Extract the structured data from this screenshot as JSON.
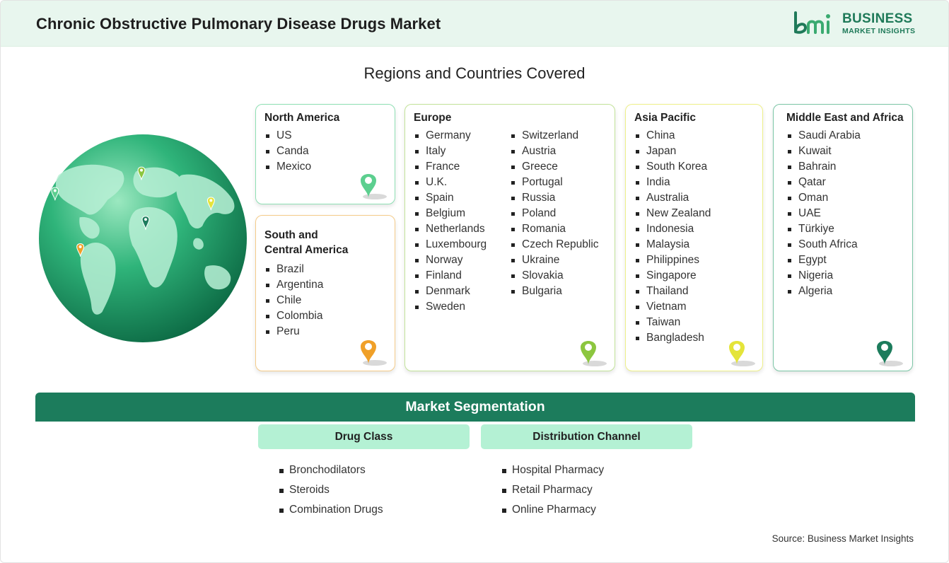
{
  "header": {
    "title": "Chronic Obstructive Pulmonary Disease Drugs Market"
  },
  "logo": {
    "line1": "BUSINESS",
    "line2": "MARKET INSIGHTS",
    "mark": "bmi"
  },
  "subtitle": "Regions and Countries Covered",
  "colors": {
    "brand": "#1f7a59",
    "north_america": "#5ccf8f",
    "south_central_america": "#f0a028",
    "europe": "#8cc63f",
    "asia_pacific": "#e4e43a",
    "middle_east_africa": "#1c7c5c"
  },
  "regions": {
    "north_america": {
      "title": "North America",
      "items": [
        "US",
        "Canda",
        "Mexico"
      ]
    },
    "south_central_america": {
      "title_line1": "South and",
      "title_line2": "Central America",
      "items": [
        "Brazil",
        "Argentina",
        "Chile",
        "Colombia",
        "Peru"
      ]
    },
    "europe": {
      "title": "Europe",
      "col1": [
        "Germany",
        "Italy",
        "France",
        "U.K.",
        "Spain",
        "Belgium",
        "Netherlands",
        "Luxembourg",
        "Norway",
        "Finland",
        "Denmark",
        "Sweden"
      ],
      "col2": [
        "Switzerland",
        "Austria",
        "Greece",
        "Portugal",
        "Russia",
        "Poland",
        "Romania",
        "Czech Republic",
        "Ukraine",
        "Slovakia",
        "Bulgaria"
      ]
    },
    "asia_pacific": {
      "title": "Asia Pacific",
      "items": [
        "China",
        "Japan",
        "South Korea",
        "India",
        "Australia",
        "New Zealand",
        "Indonesia",
        "Malaysia",
        "Philippines",
        "Singapore",
        "Thailand",
        "Vietnam",
        "Taiwan",
        "Bangladesh"
      ]
    },
    "middle_east_africa": {
      "title": "Middle East and Africa",
      "items": [
        "Saudi Arabia",
        "Kuwait",
        "Bahrain",
        "Qatar",
        "Oman",
        "UAE",
        "Türkiye",
        "South Africa",
        "Egypt",
        "Nigeria",
        "Algeria"
      ]
    }
  },
  "segmentation": {
    "title": "Market Segmentation",
    "drug_class": {
      "title": "Drug Class",
      "items": [
        "Bronchodilators",
        "Steroids",
        "Combination Drugs"
      ]
    },
    "distribution_channel": {
      "title": "Distribution Channel",
      "items": [
        "Hospital Pharmacy",
        "Retail Pharmacy",
        "Online Pharmacy"
      ]
    }
  },
  "source": "Source: Business Market Insights"
}
